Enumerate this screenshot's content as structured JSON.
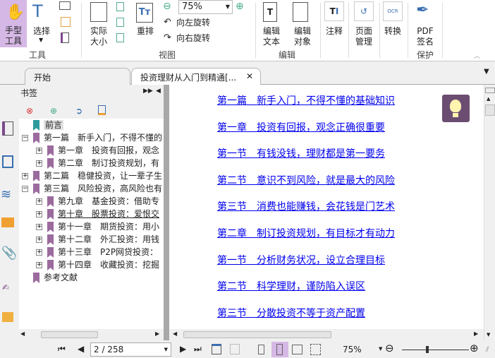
{
  "ribbon": {
    "hand_tool": "手型\n工具",
    "select": "选择",
    "actual_size": "实际\n大小",
    "reflow": "重排",
    "zoom_value": "75%",
    "rotate_left": "向左旋转",
    "rotate_right": "向右旋转",
    "edit_text": "编辑\n文本",
    "edit_object": "编辑\n对象",
    "annotate": "注释",
    "page_manage": "页面\n管理",
    "convert": "转换",
    "pdf_sign": "PDF\n签名",
    "groups": {
      "tools": "工具",
      "view": "视图",
      "edit": "编辑",
      "protect": "保护"
    }
  },
  "tabs": [
    {
      "label": "开始"
    },
    {
      "label": "投资理财从入门到精通[..."
    }
  ],
  "bookmarks": {
    "title": "书签",
    "items": [
      {
        "label": "前言",
        "level": 0
      },
      {
        "label": "第一篇　新手入门，不得不懂的",
        "level": 0,
        "expander": "−"
      },
      {
        "label": "第一章　投资有回报，观念",
        "level": 1,
        "expander": "+"
      },
      {
        "label": "第二章　制订投资规划，有",
        "level": 1,
        "expander": "+"
      },
      {
        "label": "第二篇　稳健投资，让一辈子生",
        "level": 0,
        "expander": "+"
      },
      {
        "label": "第三篇　风险投资，高风险也有",
        "level": 0,
        "expander": "−"
      },
      {
        "label": "第九章　基金投资：借助专",
        "level": 1,
        "expander": "+"
      },
      {
        "label": "第十章　股票投资：爱恨交",
        "level": 1,
        "expander": "+"
      },
      {
        "label": "第十一章　期货投资：用小",
        "level": 1,
        "expander": "+"
      },
      {
        "label": "第十二章　外汇投资：用钱",
        "level": 1,
        "expander": "+"
      },
      {
        "label": "第十三章　P2P网贷投资：",
        "level": 1,
        "expander": "+"
      },
      {
        "label": "第十四章　收藏投资：挖掘",
        "level": 1,
        "expander": "+"
      },
      {
        "label": "参考文献",
        "level": 0
      }
    ]
  },
  "document": {
    "links": [
      "第一篇　新手入门，不得不懂的基础知识",
      "第一章　投资有回报，观念正确很重要",
      "第一节　有钱没钱，理财都是第一要务",
      "第二节　意识不到风险，就是最大的风险",
      "第三节　消费也能赚钱，会花钱是门艺术",
      "第二章　制订投资规划，有目标才有动力",
      "第一节　分析财务状况，设立合理目标",
      "第二节　科学理财，谨防陷入误区",
      "第三节　分散投资不等于资产配置"
    ]
  },
  "status": {
    "page": "2 / 258",
    "zoom": "75%",
    "zoom_slider_fraction": 0.38
  },
  "colors": {
    "accent": "#d6b8e6",
    "bookmark": "#9b6b9e",
    "link": "#0000ee",
    "tip": "#6b4d72"
  }
}
